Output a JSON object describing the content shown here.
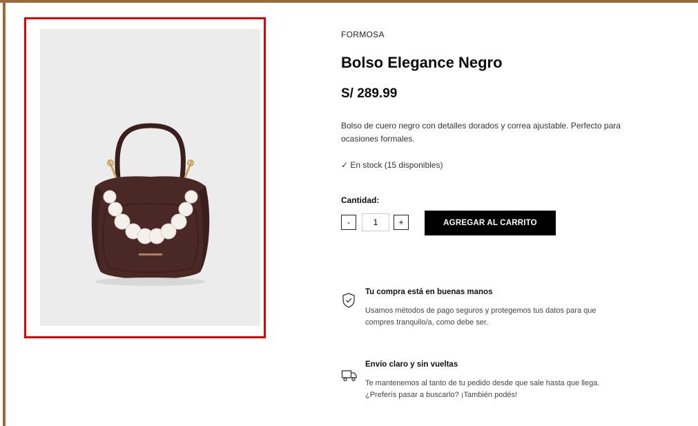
{
  "product": {
    "brand": "FORMOSA",
    "title": "Bolso Elegance Negro",
    "price": "S/ 289.99",
    "description": "Bolso de cuero negro con detalles dorados y correa ajustable. Perfecto para ocasiones formales.",
    "stock": "✓ En stock (15 disponibles)",
    "image_icon": "handbag-with-pearl-strap"
  },
  "quantity": {
    "label": "Cantidad:",
    "decrement_label": "-",
    "value": "1",
    "increment_label": "+"
  },
  "cart_button": {
    "label": "AGREGAR AL CARRITO"
  },
  "features": [
    {
      "icon": "shield-check-icon",
      "title": "Tu compra está en buenas manos",
      "text_line1": "Usamos métodos de pago seguros y protegemos tus datos para que",
      "text_line2": "compres tranquilo/a, como debe ser."
    },
    {
      "icon": "truck-icon",
      "title": "Envío claro y sin vueltas",
      "text_line1": "Te mantenemos al tanto de tu pedido desde que sale hasta que llega.",
      "text_line2": "¿Preferís pasar a buscarlo? ¡También podés!"
    }
  ],
  "colors": {
    "frame": "#9a6a3a",
    "highlight": "#e00000",
    "button_bg": "#000000"
  }
}
